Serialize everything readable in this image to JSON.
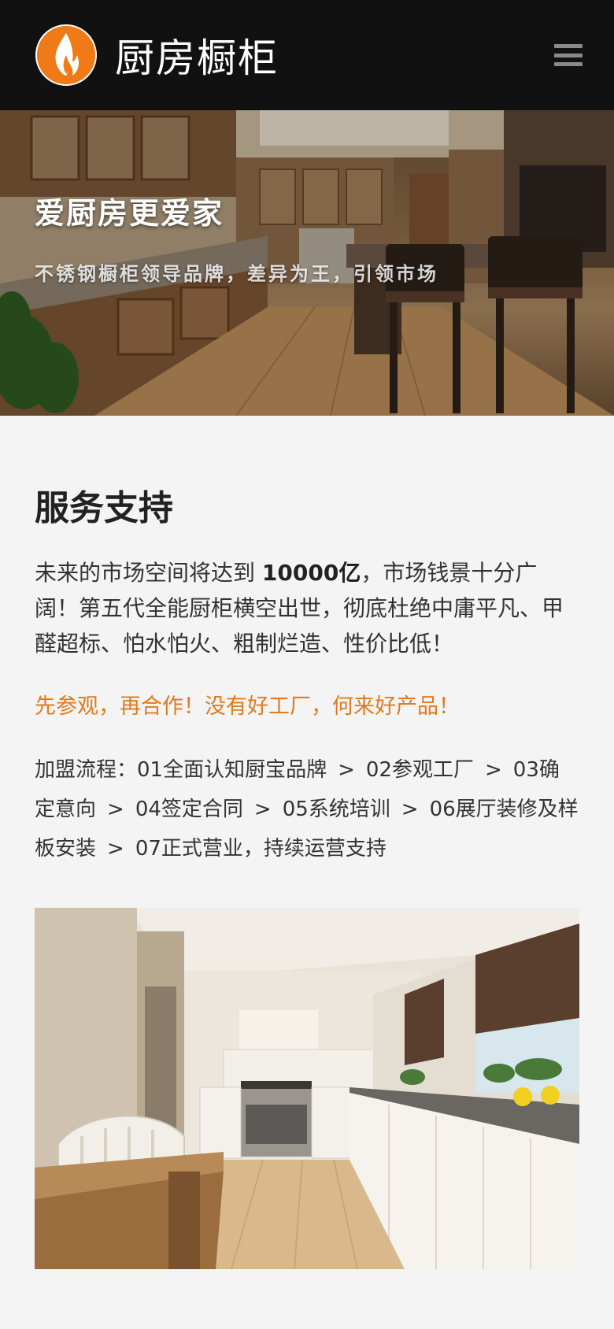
{
  "header": {
    "brand_name": "厨房橱柜",
    "logo_icon": "flame-logo-icon",
    "menu_icon": "hamburger-menu-icon"
  },
  "hero": {
    "title": "爱厨房更爱家",
    "subtitle": "不锈钢橱柜领导品牌，差异为王，引领市场"
  },
  "service": {
    "title": "服务支持",
    "intro_before": "未来的市场空间将达到 ",
    "intro_highlight": "10000亿",
    "intro_after": "，市场钱景十分广阔！第五代全能厨柜横空出世，彻底杜绝中庸平凡、甲醛超标、怕水怕火、粗制烂造、性价比低！",
    "slogan": "先参观，再合作！没有好工厂，何来好产品！",
    "process_label": "加盟流程：",
    "process_steps": [
      "01全面认知厨宝品牌",
      "02参观工厂",
      "03确定意向",
      "04签定合同",
      "05系统培训",
      "06展厅装修及样板安装",
      "07正式营业，持续运营支持"
    ],
    "separator": ">"
  },
  "colors": {
    "header_bg": "#111111",
    "accent_orange": "#e07b1f",
    "logo_orange": "#f07a18",
    "page_bg": "#f4f4f4"
  }
}
